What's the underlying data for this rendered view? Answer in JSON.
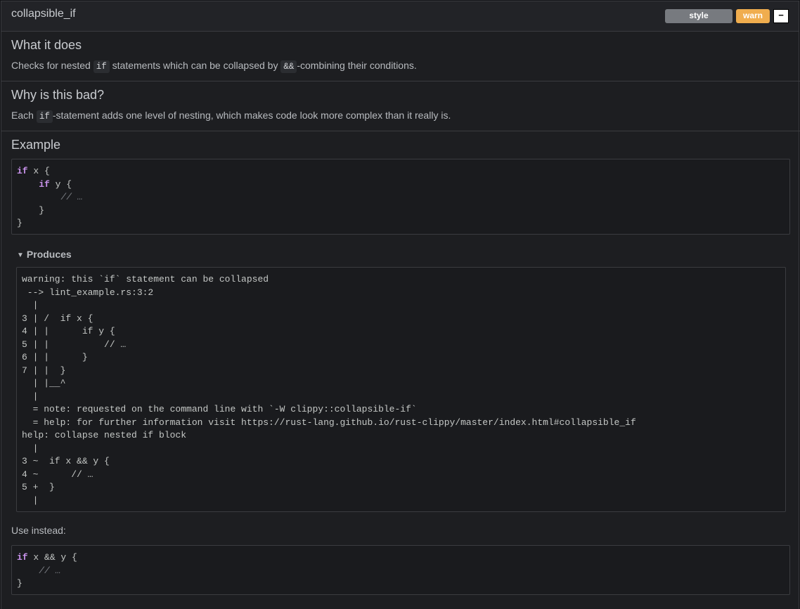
{
  "lint": {
    "name": "collapsible_if",
    "group_badge": "style",
    "level_badge": "warn",
    "collapse_label": "−"
  },
  "sections": {
    "what": {
      "heading": "What it does",
      "text_before": "Checks for nested ",
      "code1": "if",
      "text_middle": " statements which can be collapsed by ",
      "code2": "&&",
      "text_after": "-combining their conditions."
    },
    "why": {
      "heading": "Why is this bad?",
      "text_before": "Each ",
      "code1": "if",
      "text_after": "-statement adds one level of nesting, which makes code look more complex than it really is."
    },
    "example": {
      "heading": "Example",
      "code_lines": [
        [
          {
            "t": "if",
            "k": "kw"
          },
          {
            "t": " x {",
            "k": ""
          }
        ],
        [
          {
            "t": "    ",
            "k": ""
          },
          {
            "t": "if",
            "k": "kw"
          },
          {
            "t": " y {",
            "k": ""
          }
        ],
        [
          {
            "t": "        ",
            "k": ""
          },
          {
            "t": "// …",
            "k": "cm"
          }
        ],
        [
          {
            "t": "    }",
            "k": ""
          }
        ],
        [
          {
            "t": "}",
            "k": ""
          }
        ]
      ]
    },
    "produces": {
      "label": "Produces",
      "output_lines": [
        "warning: this `if` statement can be collapsed",
        " --> lint_example.rs:3:2",
        "  |",
        "3 | /  if x {",
        "4 | |      if y {",
        "5 | |          // …",
        "6 | |      }",
        "7 | |  }",
        "  | |__^",
        "  |",
        "  = note: requested on the command line with `-W clippy::collapsible-if`",
        "  = help: for further information visit https://rust-lang.github.io/rust-clippy/master/index.html#collapsible_if",
        "help: collapse nested if block",
        "  |",
        "3 ~  if x && y {",
        "4 ~      // …",
        "5 +  }",
        "  |"
      ]
    },
    "use_instead": {
      "label": "Use instead:",
      "code_lines": [
        [
          {
            "t": "if",
            "k": "kw"
          },
          {
            "t": " x && y {",
            "k": ""
          }
        ],
        [
          {
            "t": "    ",
            "k": ""
          },
          {
            "t": "// …",
            "k": "cm"
          }
        ],
        [
          {
            "t": "}",
            "k": ""
          }
        ]
      ]
    }
  },
  "colors": {
    "keyword": "#c792ea",
    "comment": "#7c7f85",
    "warn_badge": "#f0ad4e",
    "style_badge": "#777a7f"
  }
}
